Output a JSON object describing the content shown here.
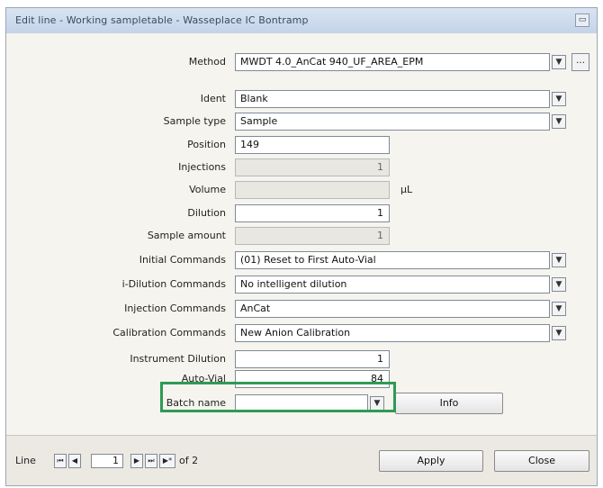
{
  "window": {
    "title": "Edit line - Working sampletable - Wasseplace IC Bontramp"
  },
  "form": {
    "method": {
      "label": "Method",
      "value": "MWDT 4.0_AnCat 940_UF_AREA_EPM"
    },
    "ident": {
      "label": "Ident",
      "value": "Blank"
    },
    "sample_type": {
      "label": "Sample type",
      "value": "Sample"
    },
    "position": {
      "label": "Position",
      "value": "149"
    },
    "injections": {
      "label": "Injections",
      "value": "1"
    },
    "volume": {
      "label": "Volume",
      "value": "",
      "unit": "µL"
    },
    "dilution": {
      "label": "Dilution",
      "value": "1"
    },
    "sample_amount": {
      "label": "Sample amount",
      "value": "1"
    },
    "initial_commands": {
      "label": "Initial Commands",
      "value": "(01) Reset to First Auto-Vial"
    },
    "idilution_commands": {
      "label": "i-Dilution Commands",
      "value": "No intelligent dilution"
    },
    "injection_commands": {
      "label": "Injection Commands",
      "value": "AnCat"
    },
    "calibration_commands": {
      "label": "Calibration Commands",
      "value": "New Anion Calibration"
    },
    "instrument_dilution": {
      "label": "Instrument Dilution",
      "value": "1"
    },
    "auto_vial": {
      "label": "Auto-Vial",
      "value": "84"
    },
    "batch_name": {
      "label": "Batch name",
      "value": ""
    },
    "info_button": "Info"
  },
  "footer": {
    "line_label": "Line",
    "line_number": "1",
    "of_label": "of 2",
    "apply_button": "Apply",
    "close_button": "Close"
  }
}
